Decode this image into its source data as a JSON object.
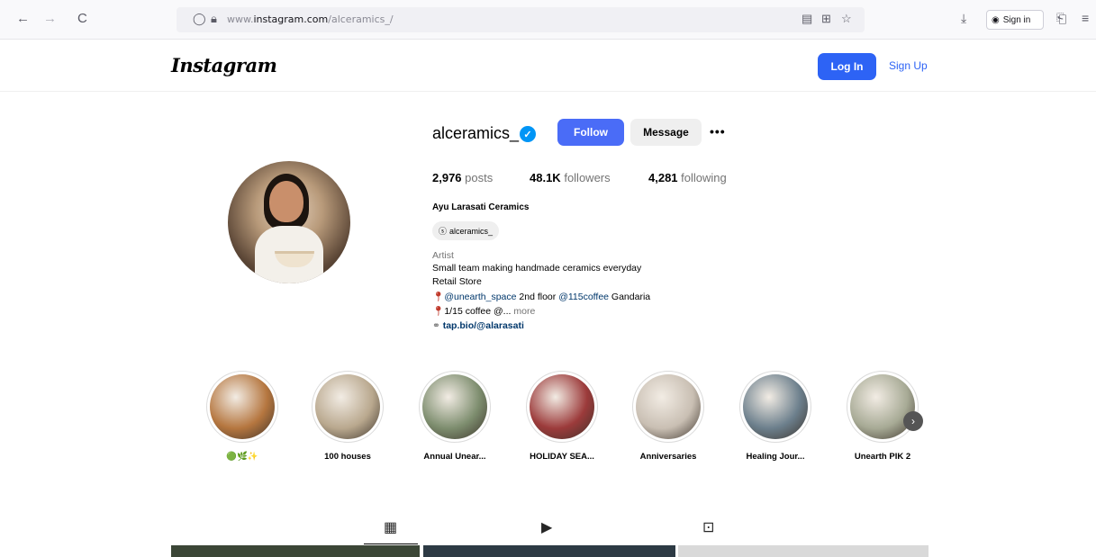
{
  "browser": {
    "back_icon": "←",
    "forward_icon": "→",
    "reload_icon": "C",
    "url_prefix": "www.",
    "url_domain": "instagram.com",
    "url_path": "/alceramics_/",
    "sign_in_label": "Sign in"
  },
  "header": {
    "logo": "Instagram",
    "login_label": "Log In",
    "signup_label": "Sign Up"
  },
  "profile": {
    "username": "alceramics_",
    "follow_label": "Follow",
    "message_label": "Message",
    "more_label": "•••",
    "posts_count": "2,976",
    "posts_label": "posts",
    "followers_count": "48.1K",
    "followers_label": "followers",
    "following_count": "4,281",
    "following_label": "following",
    "full_name": "Ayu Larasati Ceramics",
    "threads_handle": "alceramics_",
    "category": "Artist",
    "bio_line1": "Small team making handmade ceramics everyday",
    "bio_line2": "Retail Store",
    "bio_line3_tag1": "@unearth_space",
    "bio_line3_mid": " 2nd floor ",
    "bio_line3_tag2": "@115coffee",
    "bio_line3_end": " Gandaria",
    "bio_line4": "1/15 coffee @...",
    "bio_more": " more",
    "link": "tap.bio/@alarasati"
  },
  "highlights": [
    {
      "label": "🟢🌿✨",
      "color": "#b5763f"
    },
    {
      "label": "100 houses",
      "color": "#b9a88e"
    },
    {
      "label": "Annual Unear...",
      "color": "#7d8d6e"
    },
    {
      "label": "HOLIDAY SEA...",
      "color": "#9c3b3b"
    },
    {
      "label": "Anniversaries",
      "color": "#c9bfb3"
    },
    {
      "label": "Healing Jour...",
      "color": "#6c7f8c"
    },
    {
      "label": "Unearth PIK 2",
      "color": "#a7aa95"
    }
  ]
}
